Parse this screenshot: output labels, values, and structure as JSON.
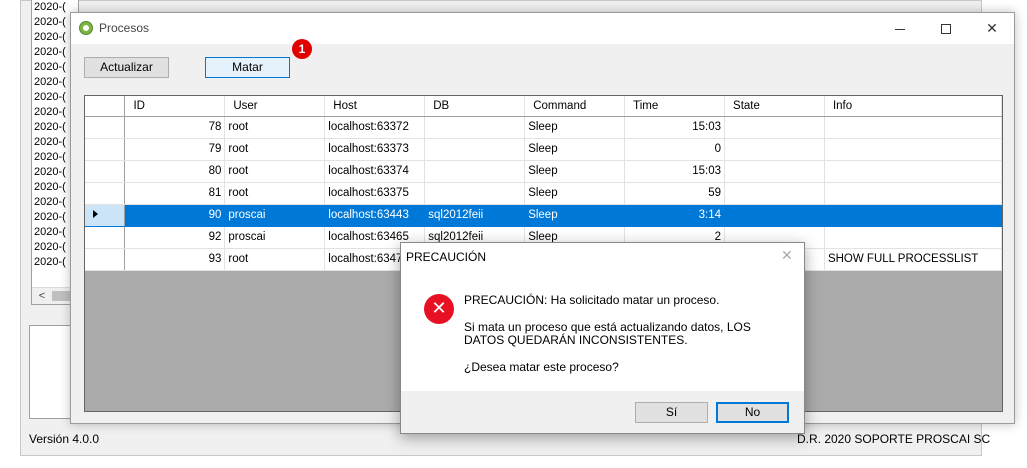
{
  "background": {
    "list_items": [
      "2020-(",
      "2020-(",
      "2020-(",
      "2020-(",
      "2020-(",
      "2020-(",
      "2020-(",
      "2020-(",
      "2020-(",
      "2020-(",
      "2020-(",
      "2020-(",
      "2020-(",
      "2020-(",
      "2020-(",
      "2020-(",
      "2020-(",
      "2020-("
    ],
    "version": "Versión 4.0.0",
    "copyright": "D.R. 2020 SOPORTE PROSCAI SC"
  },
  "window": {
    "title": "Procesos",
    "close_glyph": "✕"
  },
  "toolbar": {
    "actualizar_label": "Actualizar",
    "matar_label": "Matar",
    "badge": "1"
  },
  "grid": {
    "columns": [
      "ID",
      "User",
      "Host",
      "DB",
      "Command",
      "Time",
      "State",
      "Info"
    ],
    "rows": [
      {
        "id": "78",
        "user": "root",
        "host": "localhost:63372",
        "db": "",
        "command": "Sleep",
        "time": "15:03",
        "state": "",
        "info": ""
      },
      {
        "id": "79",
        "user": "root",
        "host": "localhost:63373",
        "db": "",
        "command": "Sleep",
        "time": "0",
        "state": "",
        "info": ""
      },
      {
        "id": "80",
        "user": "root",
        "host": "localhost:63374",
        "db": "",
        "command": "Sleep",
        "time": "15:03",
        "state": "",
        "info": ""
      },
      {
        "id": "81",
        "user": "root",
        "host": "localhost:63375",
        "db": "",
        "command": "Sleep",
        "time": "59",
        "state": "",
        "info": ""
      },
      {
        "id": "90",
        "user": "proscai",
        "host": "localhost:63443",
        "db": "sql2012feii",
        "command": "Sleep",
        "time": "3:14",
        "state": "",
        "info": ""
      },
      {
        "id": "92",
        "user": "proscai",
        "host": "localhost:63465",
        "db": "sql2012feii",
        "command": "Sleep",
        "time": "2",
        "state": "",
        "info": ""
      },
      {
        "id": "93",
        "user": "root",
        "host": "localhost:63471",
        "db": "",
        "command": "",
        "time": "",
        "state": "",
        "info": "SHOW FULL PROCESSLIST"
      }
    ]
  },
  "dialog": {
    "title": "PRECAUCIÓN",
    "close_glyph": "✕",
    "line1": "PRECAUCIÓN: Ha solicitado matar un proceso.",
    "line2": "Si mata un proceso que está actualizando datos, LOS DATOS QUEDARÁN INCONSISTENTES.",
    "line3": "¿Desea matar este proceso?",
    "yes_label": "Sí",
    "no_label": "No",
    "icon_glyph": "✕"
  }
}
